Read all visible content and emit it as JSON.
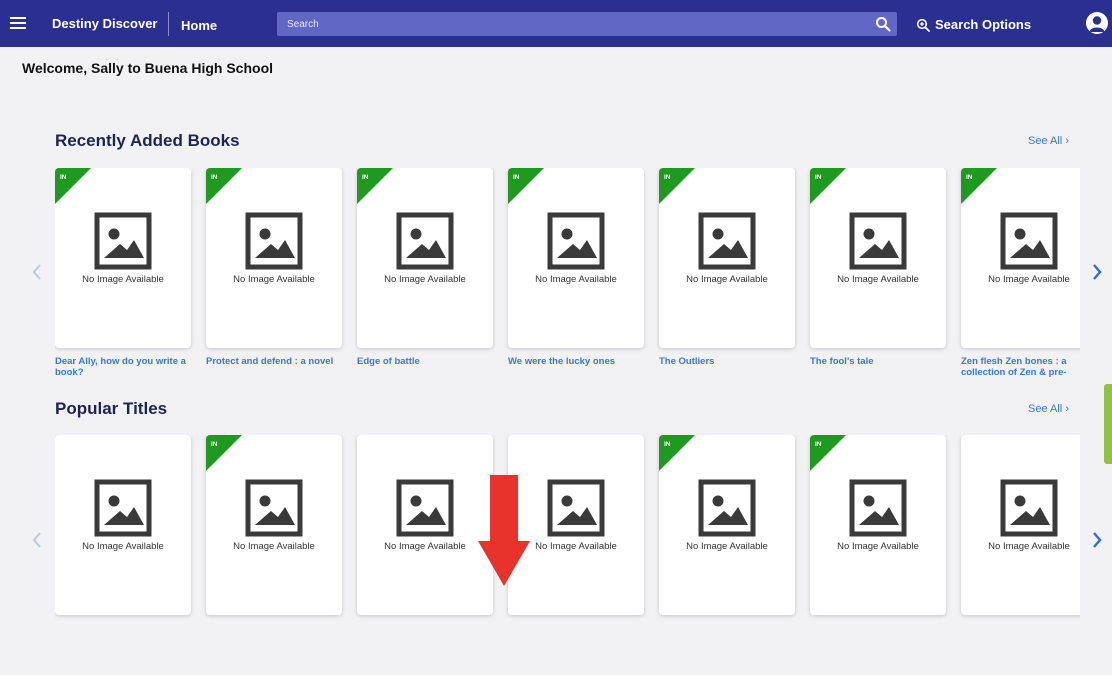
{
  "header": {
    "app_name": "Destiny Discover",
    "home_label": "Home",
    "search_placeholder": "Search",
    "search_options_label": "Search Options",
    "colors": {
      "bar": "#2b2f8f",
      "search": "#6167c4"
    }
  },
  "welcome_text": "Welcome, Sally to Buena High School",
  "recent": {
    "title": "Recently Added Books",
    "see_all": "See All",
    "no_image_text": "No Image Available",
    "badge_text": "IN",
    "books": [
      {
        "title": "Dear Ally, how do you write a book?",
        "in": true
      },
      {
        "title": "Protect and defend : a novel",
        "in": true
      },
      {
        "title": "Edge of battle",
        "in": true
      },
      {
        "title": "We were the lucky ones",
        "in": true
      },
      {
        "title": "The Outliers",
        "in": true
      },
      {
        "title": "The fool's tale",
        "in": true
      },
      {
        "title": "Zen flesh Zen bones : a collection of Zen & pre-",
        "in": true
      }
    ]
  },
  "popular": {
    "title": "Popular Titles",
    "see_all": "See All",
    "no_image_text": "No Image Available",
    "badge_text": "IN",
    "books": [
      {
        "in": false
      },
      {
        "in": true
      },
      {
        "in": false
      },
      {
        "in": false
      },
      {
        "in": true
      },
      {
        "in": true
      },
      {
        "in": false
      }
    ]
  },
  "accent_colors": {
    "link": "#3a78d6",
    "badge": "#1e9a1e",
    "annotation_arrow": "#e8332d"
  }
}
